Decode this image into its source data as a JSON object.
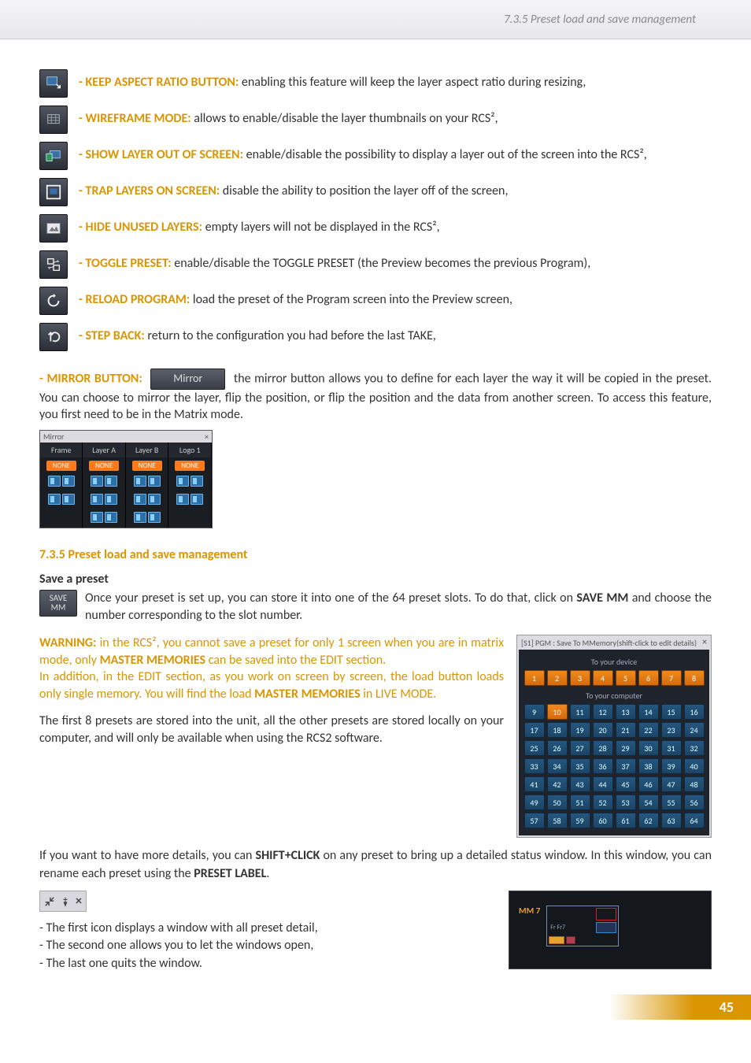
{
  "header": {
    "breadcrumb": "7.3.5 Preset load and save management"
  },
  "icons": {
    "keep_aspect": {
      "label": "- KEEP ASPECT RATIO BUTTON:",
      "text": " enabling this feature will keep the layer aspect ratio during resizing,"
    },
    "wireframe": {
      "label": "- WIREFRAME MODE:",
      "text": " allows to enable/disable the layer thumbnails on your RCS²,"
    },
    "out_of_screen": {
      "label": "- SHOW LAYER OUT OF SCREEN:",
      "text": " enable/disable the possibility to display a layer out of the screen into the RCS²,"
    },
    "trap": {
      "label": "- TRAP LAYERS ON SCREEN:",
      "text": " disable the ability to position the layer off of the screen,"
    },
    "hide_unused": {
      "label": "- HIDE UNUSED LAYERS:",
      "text": " empty layers will not be displayed in the RCS²,"
    },
    "toggle": {
      "label": "- TOGGLE PRESET:",
      "text": " enable/disable the TOGGLE PRESET (the Preview becomes the previous Program),"
    },
    "reload": {
      "label": "- RELOAD PROGRAM:",
      "text": " load the preset of the Program screen into the Preview screen,"
    },
    "step_back": {
      "label": "- STEP BACK:",
      "text": " return to the configuration you had before the last TAKE,"
    }
  },
  "mirror": {
    "label": "- MIRROR BUTTON:",
    "btn": "Mirror",
    "text": " the mirror button allows you to define for each layer the way it will be copied in the preset. You can choose to mirror the layer, flip the position, or flip the position and the data from another screen. To access this feature, you first need to be in the Matrix mode.",
    "panel": {
      "title": "Mirror",
      "cols": [
        "Frame",
        "Layer A",
        "Layer B",
        "Logo 1"
      ],
      "none": "NONE"
    }
  },
  "section": {
    "heading": "7.3.5 Preset load and save management"
  },
  "save": {
    "subhead": "Save a preset",
    "btn_l1": "SAVE",
    "btn_l2": "MM",
    "text_a": "Once your preset is set up, you can store it into one of the 64 preset slots. To do that, click on ",
    "text_b": "SAVE MM",
    "text_c": " and choose the number corresponding to the slot number."
  },
  "warning": {
    "pre": "WARNING:",
    "t1": " in the RCS², you cannot save a preset for only 1 screen when you are in matrix mode, only ",
    "mm": "MASTER MEMORIES",
    "t2": " can be saved into the EDIT section.",
    "t3": "In addition, in the EDIT section, as you work on screen by screen, the load button loads only single memory. You will find the load ",
    "t4": " in LIVE MODE."
  },
  "para1": "The first 8 presets are stored into the unit, all the other presets are stored locally on your computer, and will only be available when using the RCS2 software.",
  "para2_a": "If you want to have more details, you can ",
  "para2_b": "SHIFT+CLICK",
  "para2_c": " on any preset to bring up a detailed status window.  In this window, you can rename each preset using the ",
  "para2_d": "PRESET LABEL",
  "para2_e": ".",
  "grid": {
    "title": "[S1] PGM : Save To MMemory(shift-click to edit details)",
    "device": "To your device",
    "computer": "To your computer",
    "active": [
      1,
      2,
      3,
      4,
      5,
      6,
      7,
      8,
      10
    ]
  },
  "bullets": {
    "b1": "- The first icon displays a window with all preset detail,",
    "b2": "- The second one allows you to let the windows open,",
    "b3": "- The last one quits the window."
  },
  "mm7": {
    "label": "MM 7",
    "fr": "Fr Fr7"
  },
  "page": "45"
}
